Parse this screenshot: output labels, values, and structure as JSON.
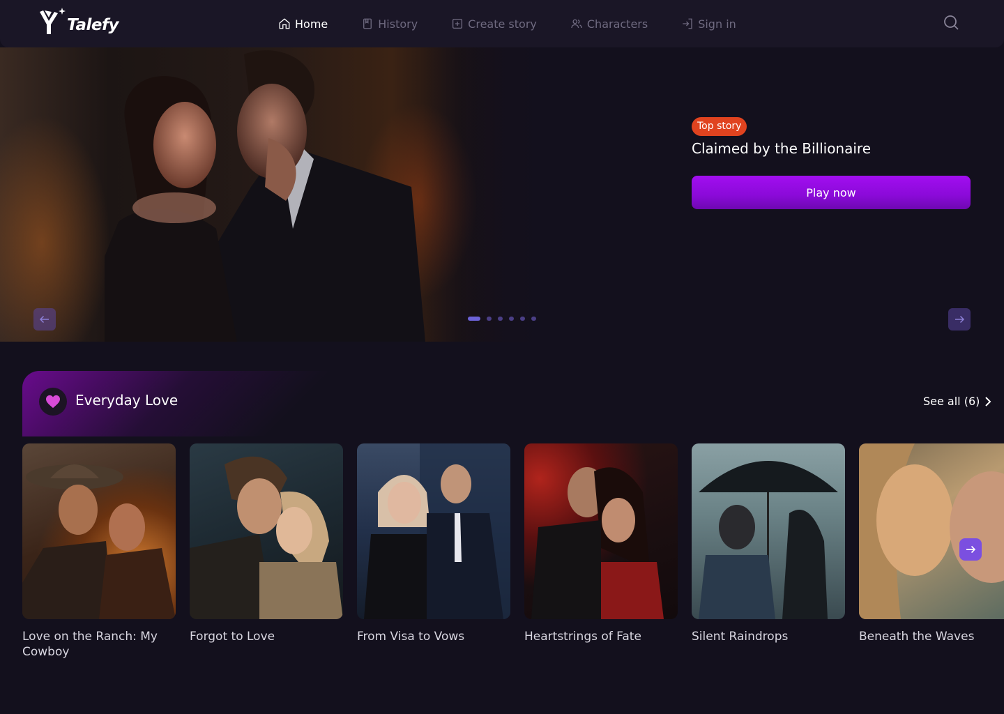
{
  "brand": {
    "name": "Talefy"
  },
  "nav": {
    "items": [
      {
        "label": "Home",
        "icon": "home-icon",
        "active": true
      },
      {
        "label": "History",
        "icon": "book-icon",
        "active": false
      },
      {
        "label": "Create story",
        "icon": "plus-square-icon",
        "active": false
      },
      {
        "label": "Characters",
        "icon": "users-icon",
        "active": false
      },
      {
        "label": "Sign in",
        "icon": "sign-in-icon",
        "active": false
      }
    ],
    "search_icon": "search-icon"
  },
  "hero": {
    "badge": "Top story",
    "title": "Claimed by the Billionaire",
    "cta": "Play now",
    "slides_total": 6,
    "active_slide": 1
  },
  "section": {
    "title": "Everyday Love",
    "icon": "heart-icon",
    "see_all": "See all (6)",
    "cards": [
      {
        "title": "Love on the Ranch: My Cowboy"
      },
      {
        "title": "Forgot to Love"
      },
      {
        "title": "From Visa to Vows"
      },
      {
        "title": "Heartstrings of Fate"
      },
      {
        "title": "Silent Raindrops"
      },
      {
        "title": "Beneath the Waves"
      }
    ]
  },
  "colors": {
    "background": "#13101d",
    "nav_background": "#1a1626",
    "badge": "#e0431f",
    "cta": "#9a0ce8",
    "accent": "#7b4fe0",
    "heart": "#d84bd8"
  }
}
